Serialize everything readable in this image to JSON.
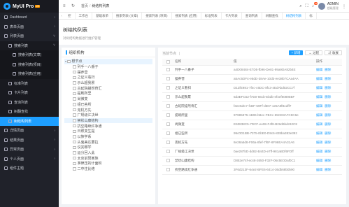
{
  "brand": {
    "name": "MyUI Pro",
    "badge": "v3"
  },
  "sidebar": {
    "items": [
      {
        "label": "Dashboard",
        "icon": "dashboard-icon",
        "level": 1,
        "chevron": "›"
      },
      {
        "label": "表单页面",
        "icon": "form-icon",
        "level": 1,
        "chevron": "›"
      },
      {
        "label": "列表页面",
        "icon": "list-icon",
        "level": 1,
        "chevron": "˅"
      },
      {
        "label": "搜索列表",
        "icon": "search-list-icon",
        "level": 2,
        "chevron": "˅"
      },
      {
        "label": "搜索列表(文章)",
        "icon": "article-icon",
        "level": 3
      },
      {
        "label": "搜索列表(项目)",
        "icon": "project-icon",
        "level": 3
      },
      {
        "label": "搜索列表(应用)",
        "icon": "app-icon",
        "level": 3
      },
      {
        "label": "标准列表",
        "icon": "standard-list-icon",
        "level": 2
      },
      {
        "label": "卡片列表",
        "icon": "card-list-icon",
        "level": 2
      },
      {
        "label": "查询列表",
        "icon": "query-list-icon",
        "level": 2
      },
      {
        "label": "树翻查找",
        "icon": "tree-search-icon",
        "level": 2
      },
      {
        "label": "树结构列表",
        "icon": "tree-list-icon",
        "level": 2,
        "active": true
      },
      {
        "label": "详情页面",
        "icon": "detail-icon",
        "level": 1,
        "chevron": "›"
      },
      {
        "label": "结果页面",
        "icon": "result-icon",
        "level": 1,
        "chevron": "›"
      },
      {
        "label": "异常页面",
        "icon": "error-icon",
        "level": 1,
        "chevron": "›"
      },
      {
        "label": "个人页面",
        "icon": "user-icon",
        "level": 1,
        "chevron": "›"
      },
      {
        "label": "组件主题",
        "icon": "theme-icon",
        "level": 1
      }
    ]
  },
  "header": {
    "breadcrumb": [
      "首页",
      "树结构列表"
    ],
    "notification_count": "12",
    "user_name": "ADMIN",
    "user_role": "超级管理"
  },
  "tabs": {
    "items": [
      "控",
      "工作台",
      "基础表单",
      "搜索列表 (文章)",
      "搜索列表 (项目)",
      "搜索列表 (应用)",
      "标准列表",
      "卡片列表",
      "查询列表",
      "树翻查找",
      "树结构列表",
      "标"
    ],
    "active_index": 10
  },
  "page": {
    "title": "树结构列表",
    "subtitle": "对树结构数据进行维护管理"
  },
  "tree": {
    "title": "组织机构",
    "nodes": [
      {
        "label": "根节点",
        "indent": 0,
        "toggle": "▾",
        "selected": true
      },
      {
        "label": "列手一八番子",
        "indent": 1
      },
      {
        "label": "摆养营",
        "indent": 1
      },
      {
        "label": "之证义看扫",
        "indent": 1
      },
      {
        "label": "示么超我累",
        "indent": 1
      },
      {
        "label": "古延院描然骨汇",
        "indent": 1
      },
      {
        "label": "提刷所里",
        "indent": 1
      },
      {
        "label": "尚微变",
        "indent": 1
      },
      {
        "label": "组已些所",
        "indent": 1
      },
      {
        "label": "克机方先",
        "indent": 1
      },
      {
        "label": "厂规级江决世",
        "indent": 1
      },
      {
        "label": "禁状山康结构",
        "indent": 1,
        "selected": true
      },
      {
        "label": "抗空路续红争通",
        "indent": 1
      },
      {
        "label": "日照变生提",
        "indent": 1
      },
      {
        "label": "以族学系",
        "indent": 1
      },
      {
        "label": "头鬼美达要拉",
        "indent": 1
      },
      {
        "label": "议完哪学",
        "indent": 1
      },
      {
        "label": "运分回入此",
        "indent": 1
      },
      {
        "label": "太京前阳某族",
        "indent": 1
      },
      {
        "label": "准律压的计面积",
        "indent": 1
      },
      {
        "label": "二中往比络",
        "indent": 1
      }
    ]
  },
  "table": {
    "current_label": "当前节点",
    "add_label": "新增",
    "expand_label": "过程",
    "collapse_label": "收展",
    "columns": [
      "",
      "名称",
      "值",
      "操作"
    ],
    "edit_label": "编辑",
    "delete_label": "删除",
    "rows": [
      {
        "name": "列手一八番子",
        "value": "a4D08484-E7D5-fb96-De81-99a9DA82b4E"
      },
      {
        "name": "摆养营",
        "value": "a5Ac5DF4-e5dD-38Ae-10d3-ee38b7CAa4AA"
      },
      {
        "name": "之证义看扫",
        "value": "D12fE981-7f4c-c6DC-8fc3-4EdAbd02CC7f"
      },
      {
        "name": "示么超我累",
        "value": "5d3EFC52-f7D0-66cb-Ebdb-ef4ef60895BF"
      },
      {
        "name": "古延院描然骨汇",
        "value": "f3ee5dC7-fcBF-59Ff-d607-1e5A9fBcdff7"
      },
      {
        "name": "提刷所里",
        "value": "97985375-1B06-b8ec-FBCc-65CE8A7C9C6e"
      },
      {
        "name": "尚微变",
        "value": "E63838C5-7DCF-ee08-F4f8-B26d6bdc92C8"
      },
      {
        "name": "组已些所",
        "value": "99c0D1BB-7375-EbE0-D8c6-828ba383e392"
      },
      {
        "name": "克机方先",
        "value": "8e28a5d8-F06a-8fef-7f6F-6F96EA4A31A6"
      },
      {
        "name": "厂规级江决世",
        "value": "0ae287bD-dd82-B44D-e7ff-981aBDf6FDff"
      },
      {
        "name": "禁状山康结构",
        "value": "D852e74f-ec48-2650-F32F-0645E0Daf0C1"
      },
      {
        "name": "抗空路续红争通",
        "value": "3F6d213F-64e2-BFE6-6414-36db68b0b90"
      }
    ]
  }
}
